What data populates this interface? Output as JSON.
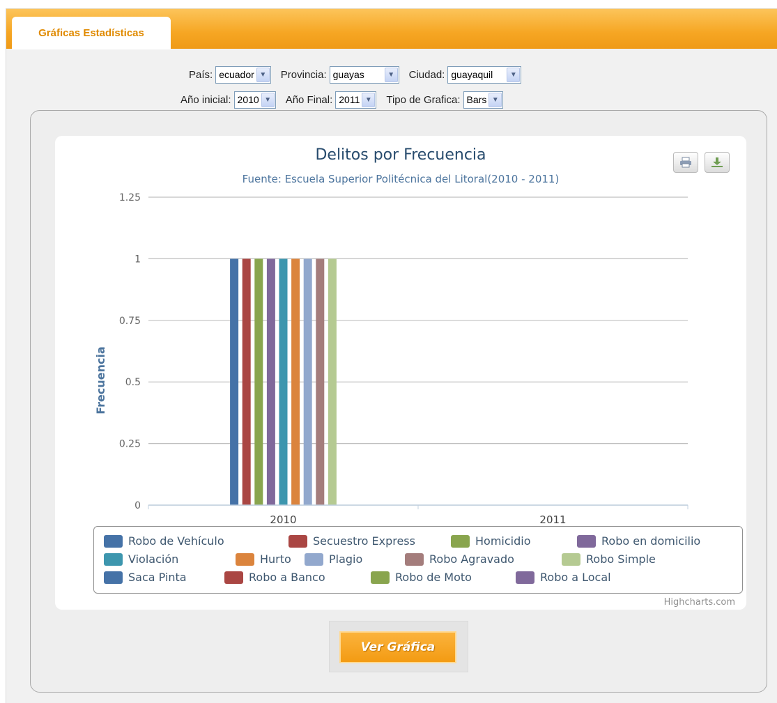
{
  "tab": {
    "label": "Gráficas Estadísticas"
  },
  "filters": {
    "pais": {
      "label": "País:",
      "value": "ecuador"
    },
    "provincia": {
      "label": "Provincia:",
      "value": "guayas"
    },
    "ciudad": {
      "label": "Ciudad:",
      "value": "guayaquil"
    },
    "anio_inicial": {
      "label": "Año inicial:",
      "value": "2010"
    },
    "anio_final": {
      "label": "Año Final:",
      "value": "2011"
    },
    "tipo_grafica": {
      "label": "Tipo de Grafica:",
      "value": "Bars"
    }
  },
  "icons": {
    "print": "print-icon",
    "export": "download-icon",
    "dropdown": "chevron-down-icon"
  },
  "credits": "Highcharts.com",
  "action_button": {
    "label": "Ver Gráfica"
  },
  "chart_data": {
    "type": "bar",
    "title": "Delitos por Frecuencia",
    "subtitle": "Fuente: Escuela Superior Politécnica del Litoral(2010 - 2011)",
    "xlabel": "",
    "ylabel": "Frecuencia",
    "categories": [
      "2010",
      "2011"
    ],
    "ylim": [
      0,
      1.25
    ],
    "yticks": [
      "0",
      "0.25",
      "0.5",
      "0.75",
      "1",
      "1.25"
    ],
    "grid": true,
    "legend_position": "bottom",
    "series": [
      {
        "name": "Robo de Vehículo",
        "color": "#4572a7",
        "values": [
          1,
          0
        ]
      },
      {
        "name": "Secuestro Express",
        "color": "#aa4643",
        "values": [
          1,
          0
        ]
      },
      {
        "name": "Homicidio",
        "color": "#89a54e",
        "values": [
          1,
          0
        ]
      },
      {
        "name": "Robo en domicilio",
        "color": "#80699b",
        "values": [
          1,
          0
        ]
      },
      {
        "name": "Violación",
        "color": "#3d96ae",
        "values": [
          1,
          0
        ]
      },
      {
        "name": "Hurto",
        "color": "#db843d",
        "values": [
          1,
          0
        ]
      },
      {
        "name": "Plagio",
        "color": "#92a8cd",
        "values": [
          1,
          0
        ]
      },
      {
        "name": "Robo Agravado",
        "color": "#a47d7c",
        "values": [
          1,
          0
        ]
      },
      {
        "name": "Robo Simple",
        "color": "#b5ca92",
        "values": [
          1,
          0
        ]
      },
      {
        "name": "Saca Pinta",
        "color": "#4572a7",
        "values": [
          0,
          0
        ]
      },
      {
        "name": "Robo a Banco",
        "color": "#aa4643",
        "values": [
          0,
          0
        ]
      },
      {
        "name": "Robo de Moto",
        "color": "#89a54e",
        "values": [
          0,
          0
        ]
      },
      {
        "name": "Robo a Local",
        "color": "#80699b",
        "values": [
          0,
          0
        ]
      }
    ]
  }
}
